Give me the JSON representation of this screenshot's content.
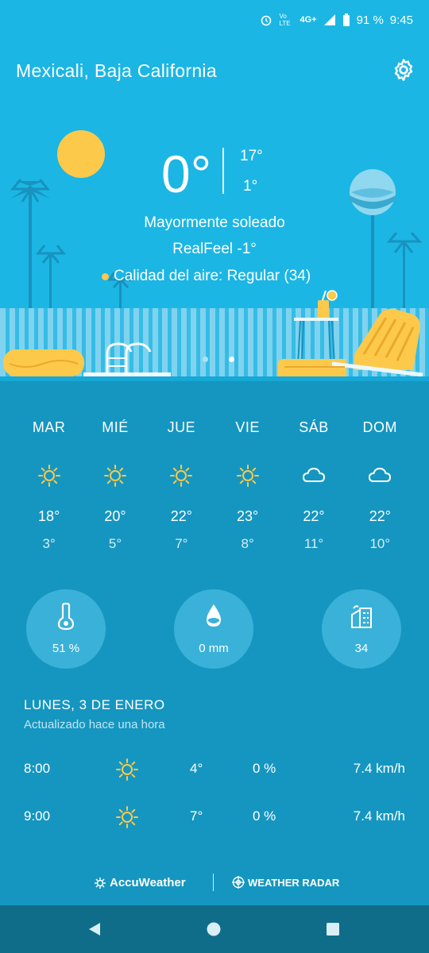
{
  "status_bar": {
    "network": "4G+",
    "volte": "Vo LTE",
    "battery": "91 %",
    "time": "9:45"
  },
  "location": "Mexicali, Baja California",
  "current": {
    "temp": "0°",
    "high": "17°",
    "low": "1°",
    "condition": "Mayormente soleado",
    "realfeel": "RealFeel -1°",
    "air_quality": "Calidad del aire: Regular (34)"
  },
  "page_indicator": {
    "pages": 2,
    "active": 2
  },
  "forecast": [
    {
      "day": "MAR",
      "icon": "sun-icon",
      "high": "18°",
      "low": "3°"
    },
    {
      "day": "MIÉ",
      "icon": "sun-icon",
      "high": "20°",
      "low": "5°"
    },
    {
      "day": "JUE",
      "icon": "sun-icon",
      "high": "22°",
      "low": "7°"
    },
    {
      "day": "VIE",
      "icon": "sun-icon",
      "high": "23°",
      "low": "8°"
    },
    {
      "day": "SÁB",
      "icon": "cloud-icon",
      "high": "22°",
      "low": "11°"
    },
    {
      "day": "DOM",
      "icon": "cloud-icon",
      "high": "22°",
      "low": "10°"
    }
  ],
  "stats": {
    "humidity": {
      "icon": "humidity-icon",
      "value": "51 %"
    },
    "precipitation": {
      "icon": "raindrop-icon",
      "value": "0 mm"
    },
    "air_quality": {
      "icon": "city-air-icon",
      "value": "34"
    }
  },
  "date_header": "LUNES, 3 DE ENERO",
  "updated": "Actualizado hace una hora",
  "hourly": [
    {
      "time": "8:00",
      "icon": "sun-icon",
      "temp": "4°",
      "precip": "0 %",
      "wind": "7.4 km/h"
    },
    {
      "time": "9:00",
      "icon": "sun-icon",
      "temp": "7°",
      "precip": "0 %",
      "wind": "7.4 km/h"
    }
  ],
  "footer": {
    "accuweather": "AccuWeather",
    "radar": "WEATHER RADAR"
  },
  "colors": {
    "sky": "#1bb6e4",
    "body": "#1596c0",
    "sun": "#fdc94a",
    "navbar": "#0f6d8a"
  }
}
